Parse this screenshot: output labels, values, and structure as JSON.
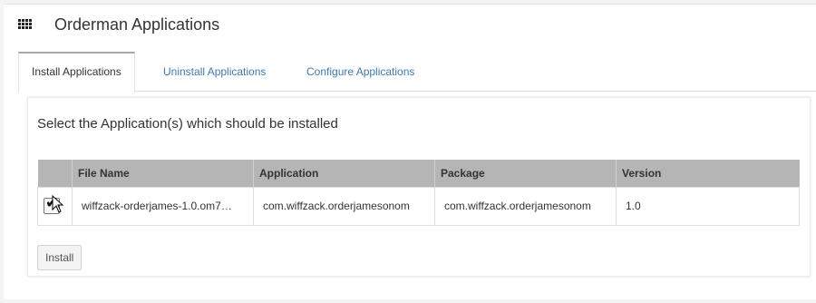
{
  "header": {
    "title": "Orderman Applications",
    "icon": "apps-grid-icon"
  },
  "tabs": [
    {
      "label": "Install Applications",
      "active": true
    },
    {
      "label": "Uninstall Applications",
      "active": false
    },
    {
      "label": "Configure Applications",
      "active": false
    }
  ],
  "panel": {
    "heading": "Select the Application(s) which should be installed",
    "columns": [
      "",
      "File Name",
      "Application",
      "Package",
      "Version"
    ],
    "rows": [
      {
        "checked": true,
        "file_name": "wiffzack-orderjames-1.0.om7…",
        "application": "com.wiffzack.orderjamesonom",
        "package": "com.wiffzack.orderjamesonom",
        "version": "1.0"
      }
    ],
    "install_label": "Install"
  },
  "colors": {
    "link": "#3c7ab8",
    "table_header_bg": "#b5b5b5"
  }
}
